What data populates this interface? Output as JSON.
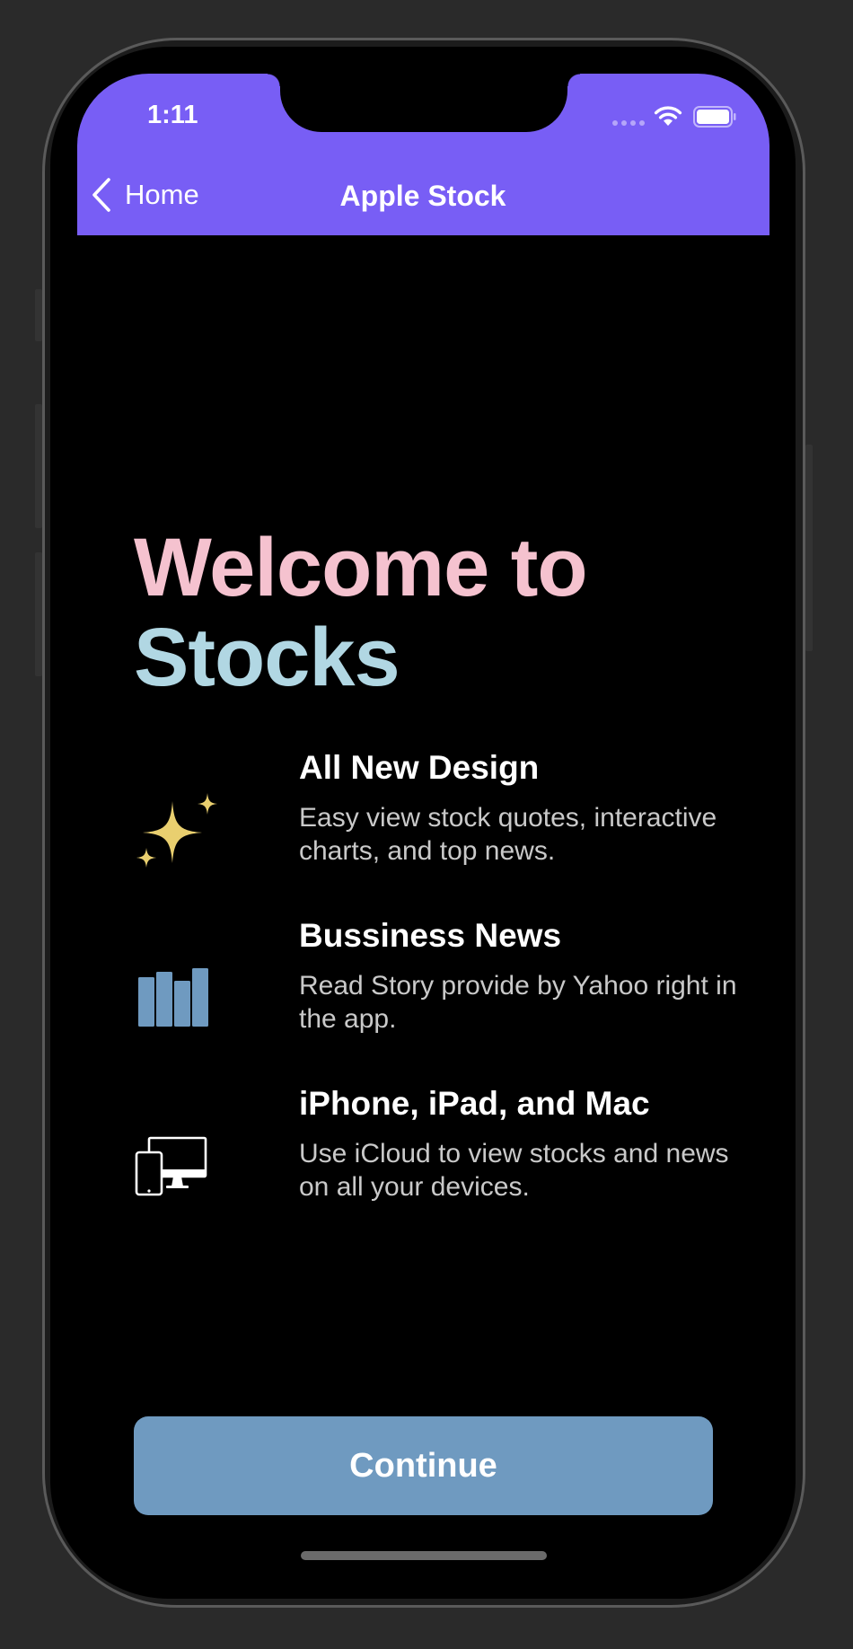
{
  "status_bar": {
    "time": "1:11"
  },
  "nav": {
    "back_label": "Home",
    "title": "Apple Stock"
  },
  "welcome": {
    "line1": "Welcome to",
    "line2": "Stocks"
  },
  "features": [
    {
      "icon": "sparkles-icon",
      "title": "All New Design",
      "description": "Easy view stock quotes, interactive charts, and top news."
    },
    {
      "icon": "bar-chart-icon",
      "title": "Bussiness News",
      "description": "Read Story provide by Yahoo right in the app."
    },
    {
      "icon": "devices-icon",
      "title": "iPhone, iPad, and Mac",
      "description": "Use iCloud to view stocks and news on all your devices."
    }
  ],
  "continue_label": "Continue",
  "colors": {
    "nav_background": "#785ef5",
    "welcome_line1": "#f5c2cf",
    "welcome_line2": "#b1d7e3",
    "sparkles": "#e9cf6f",
    "bar_chart": "#6f9ac0",
    "continue_button": "#6f9ac0"
  }
}
